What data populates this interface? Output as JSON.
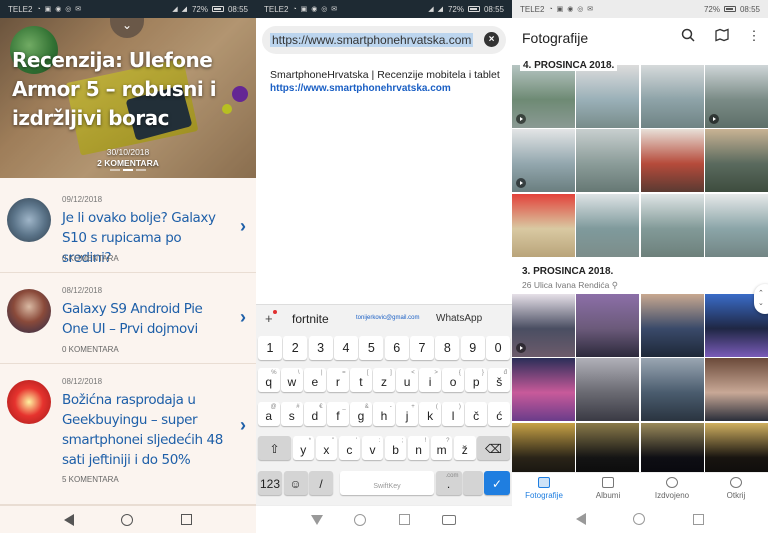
{
  "status": {
    "carrier": "TELE2",
    "battery": "72%",
    "time": "08:55"
  },
  "news": {
    "hero": {
      "title": "Recenzija: Ulefone Armor 5 – robusni i izdržljivi borac",
      "date": "30/10/2018",
      "comments": "2 KOMENTARA"
    },
    "articles": [
      {
        "date": "09/12/2018",
        "title": "Je li ovako bolje? Galaxy S10 s rupicama po sredini?",
        "comments": "0 KOMENTARA"
      },
      {
        "date": "08/12/2018",
        "title": "Galaxy S9 Android Pie One UI – Prvi dojmovi",
        "comments": "0 KOMENTARA"
      },
      {
        "date": "08/12/2018",
        "title": "Božićna rasprodaja u Geekbuyingu – super smartphonei sljedećih 48 sati jeftiniji i do 50%",
        "comments": "5 KOMENTARA"
      }
    ]
  },
  "browser": {
    "url": "https://www.smartphonehrvatska.com",
    "suggestion_title": "SmartphoneHrvatska | Recenzije mobitela i tablet",
    "suggestion_url": "https://www.smartphonehrvatska.com"
  },
  "keyboard": {
    "predictions": [
      "fortnite",
      "tonijerkovic@gmail.com",
      "WhatsApp"
    ],
    "num_row": [
      "1",
      "2",
      "3",
      "4",
      "5",
      "6",
      "7",
      "8",
      "9",
      "0"
    ],
    "row1": [
      "q",
      "w",
      "e",
      "r",
      "t",
      "z",
      "u",
      "i",
      "o",
      "p",
      "š"
    ],
    "row1_sub": [
      "%",
      "\\",
      "|",
      "=",
      "[",
      "]",
      "<",
      ">",
      "{",
      "}",
      "đ"
    ],
    "row2": [
      "a",
      "s",
      "d",
      "f",
      "g",
      "h",
      "j",
      "k",
      "l",
      "č",
      "ć"
    ],
    "row2_sub": [
      "@",
      "#",
      "€",
      "_",
      "&",
      "-",
      "+",
      "(",
      ")",
      "",
      ""
    ],
    "row3": [
      "y",
      "x",
      "c",
      "v",
      "b",
      "n",
      "m",
      "ž"
    ],
    "row3_sub": [
      "*",
      "\"",
      "'",
      ":",
      ";",
      "!",
      "?",
      ""
    ],
    "numbers_key": "123",
    "slash_key": "/",
    "space_label": "SwiftKey",
    "dot_key": ".",
    "dot_sub": ".com"
  },
  "gallery": {
    "title": "Fotografije",
    "section1": "4. PROSINCA 2018.",
    "section2": "3. PROSINCA 2018.",
    "section2_location": "26 Ulica Ivana Rendića",
    "tabs": [
      "Fotografije",
      "Albumi",
      "Izdvojeno",
      "Otkrij"
    ]
  }
}
